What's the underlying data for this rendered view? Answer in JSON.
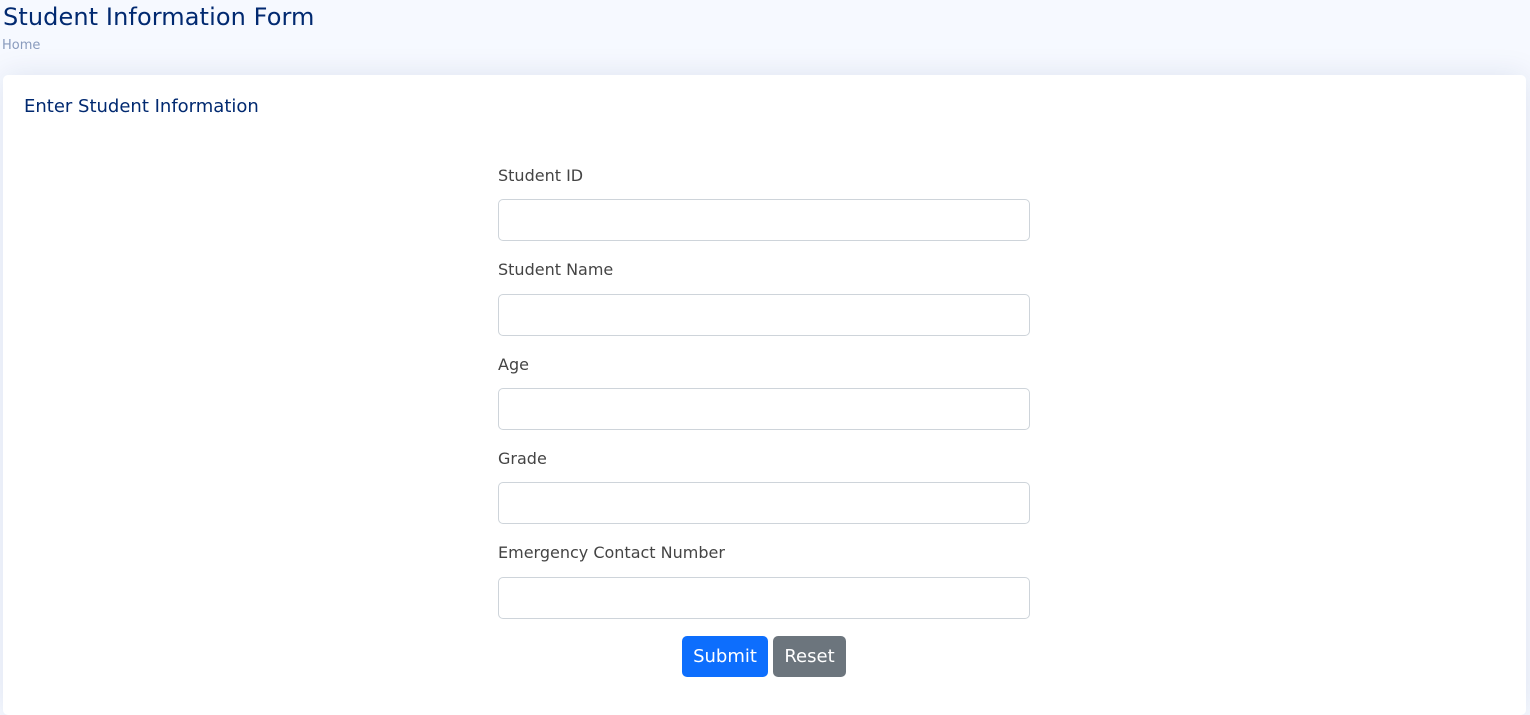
{
  "header": {
    "title": "Student Information Form",
    "breadcrumb": "Home"
  },
  "card": {
    "title": "Enter Student Information"
  },
  "form": {
    "fields": [
      {
        "label": "Student ID",
        "value": ""
      },
      {
        "label": "Student Name",
        "value": ""
      },
      {
        "label": "Age",
        "value": ""
      },
      {
        "label": "Grade",
        "value": ""
      },
      {
        "label": "Emergency Contact Number",
        "value": ""
      }
    ],
    "submit_label": "Submit",
    "reset_label": "Reset"
  },
  "colors": {
    "title": "#012970",
    "breadcrumb": "#899bbd",
    "submit": "#0d6efd",
    "reset": "#6c757d"
  }
}
